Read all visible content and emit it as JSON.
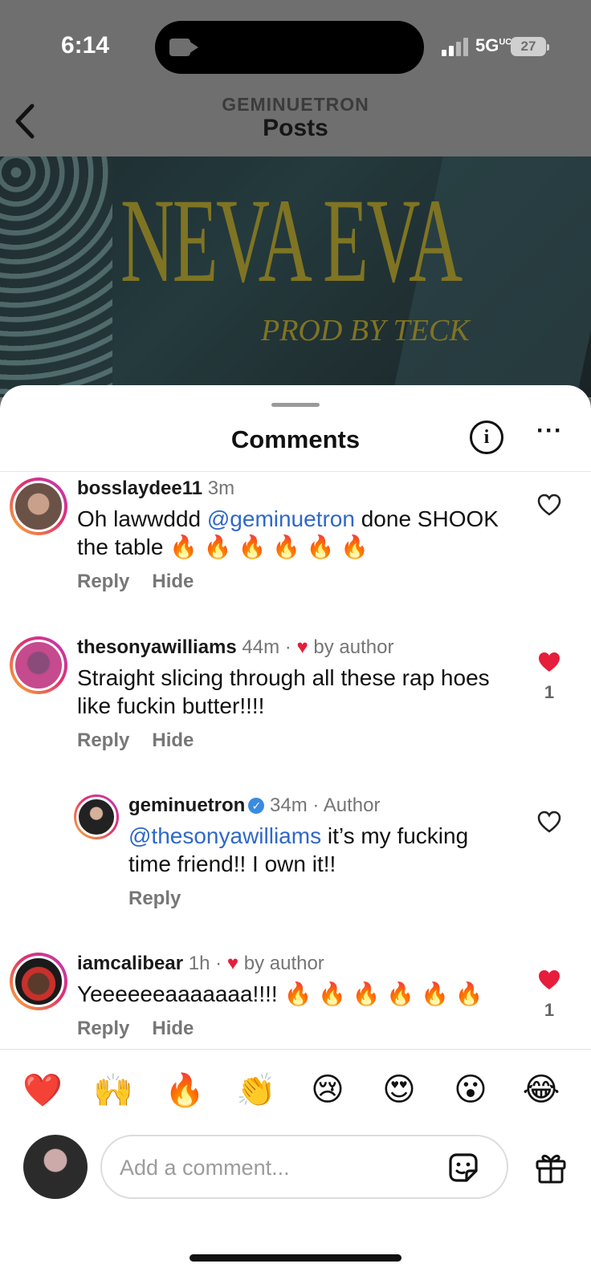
{
  "status_bar": {
    "time": "6:14",
    "network": "5G",
    "network_suffix": "UC",
    "battery": "27"
  },
  "nav": {
    "account": "GEMINUETRON",
    "page": "Posts"
  },
  "post": {
    "title_art": "NEVA EVA",
    "subtitle_art": "PROD BY TECK"
  },
  "sheet": {
    "title": "Comments"
  },
  "comments": [
    {
      "user": "bosslaydee11",
      "time": "3m",
      "text_parts": [
        "Oh lawwddd ",
        "@geminuetron",
        " done SHOOK the table 🔥 🔥 🔥 🔥 🔥 🔥"
      ],
      "actions": [
        "Reply",
        "Hide"
      ],
      "liked": false,
      "likes": ""
    },
    {
      "user": "thesonyawilliams",
      "time": "44m",
      "sep": "·",
      "badge": "by author",
      "text": "Straight slicing through all these rap hoes like fuckin butter!!!!",
      "actions": [
        "Reply",
        "Hide"
      ],
      "liked": true,
      "likes": "1"
    },
    {
      "user": "geminuetron",
      "time": "34m",
      "sep": "·",
      "badge": "Author",
      "verified": true,
      "text_parts": [
        "@thesonyawilliams",
        " it’s my fucking time friend!! I own it!!"
      ],
      "actions": [
        "Reply"
      ],
      "liked": false,
      "likes": ""
    },
    {
      "user": "iamcalibear",
      "time": "1h",
      "sep": "·",
      "badge": "by author",
      "text": "Yeeeeeeaaaaaaa!!!! 🔥 🔥 🔥 🔥 🔥 🔥",
      "actions": [
        "Reply",
        "Hide"
      ],
      "liked": true,
      "likes": "1"
    }
  ],
  "reactions": [
    "❤️",
    "🙌",
    "🔥",
    "👏",
    "😢",
    "😍",
    "😮",
    "😂"
  ],
  "composer": {
    "placeholder": "Add a comment..."
  },
  "icons": {
    "back": "chevron-left-icon",
    "info": "info-icon",
    "more": "more-horizontal-icon",
    "like_empty": "heart-outline-icon",
    "like_filled": "heart-filled-icon",
    "sticker": "sticker-icon",
    "gift": "gift-icon",
    "verified": "verified-badge-icon"
  },
  "colors": {
    "like_red": "#e61d3b",
    "mention_blue": "#2f68c9",
    "verified_blue": "#3a8be0",
    "art_gold": "#7f7423"
  }
}
